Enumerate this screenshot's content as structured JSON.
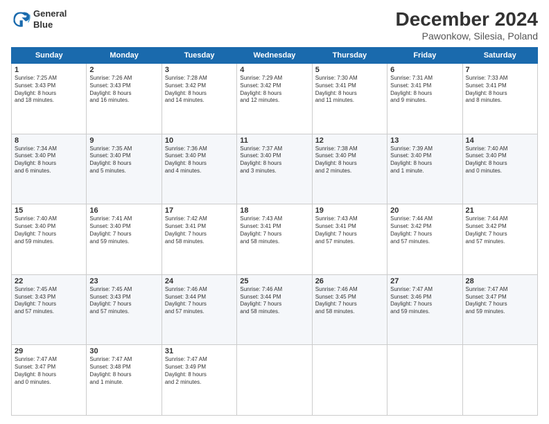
{
  "header": {
    "logo_line1": "General",
    "logo_line2": "Blue",
    "main_title": "December 2024",
    "subtitle": "Pawonkow, Silesia, Poland"
  },
  "weekdays": [
    "Sunday",
    "Monday",
    "Tuesday",
    "Wednesday",
    "Thursday",
    "Friday",
    "Saturday"
  ],
  "weeks": [
    [
      {
        "day": "1",
        "lines": [
          "Sunrise: 7:25 AM",
          "Sunset: 3:43 PM",
          "Daylight: 8 hours",
          "and 18 minutes."
        ]
      },
      {
        "day": "2",
        "lines": [
          "Sunrise: 7:26 AM",
          "Sunset: 3:43 PM",
          "Daylight: 8 hours",
          "and 16 minutes."
        ]
      },
      {
        "day": "3",
        "lines": [
          "Sunrise: 7:28 AM",
          "Sunset: 3:42 PM",
          "Daylight: 8 hours",
          "and 14 minutes."
        ]
      },
      {
        "day": "4",
        "lines": [
          "Sunrise: 7:29 AM",
          "Sunset: 3:42 PM",
          "Daylight: 8 hours",
          "and 12 minutes."
        ]
      },
      {
        "day": "5",
        "lines": [
          "Sunrise: 7:30 AM",
          "Sunset: 3:41 PM",
          "Daylight: 8 hours",
          "and 11 minutes."
        ]
      },
      {
        "day": "6",
        "lines": [
          "Sunrise: 7:31 AM",
          "Sunset: 3:41 PM",
          "Daylight: 8 hours",
          "and 9 minutes."
        ]
      },
      {
        "day": "7",
        "lines": [
          "Sunrise: 7:33 AM",
          "Sunset: 3:41 PM",
          "Daylight: 8 hours",
          "and 8 minutes."
        ]
      }
    ],
    [
      {
        "day": "8",
        "lines": [
          "Sunrise: 7:34 AM",
          "Sunset: 3:40 PM",
          "Daylight: 8 hours",
          "and 6 minutes."
        ]
      },
      {
        "day": "9",
        "lines": [
          "Sunrise: 7:35 AM",
          "Sunset: 3:40 PM",
          "Daylight: 8 hours",
          "and 5 minutes."
        ]
      },
      {
        "day": "10",
        "lines": [
          "Sunrise: 7:36 AM",
          "Sunset: 3:40 PM",
          "Daylight: 8 hours",
          "and 4 minutes."
        ]
      },
      {
        "day": "11",
        "lines": [
          "Sunrise: 7:37 AM",
          "Sunset: 3:40 PM",
          "Daylight: 8 hours",
          "and 3 minutes."
        ]
      },
      {
        "day": "12",
        "lines": [
          "Sunrise: 7:38 AM",
          "Sunset: 3:40 PM",
          "Daylight: 8 hours",
          "and 2 minutes."
        ]
      },
      {
        "day": "13",
        "lines": [
          "Sunrise: 7:39 AM",
          "Sunset: 3:40 PM",
          "Daylight: 8 hours",
          "and 1 minute."
        ]
      },
      {
        "day": "14",
        "lines": [
          "Sunrise: 7:40 AM",
          "Sunset: 3:40 PM",
          "Daylight: 8 hours",
          "and 0 minutes."
        ]
      }
    ],
    [
      {
        "day": "15",
        "lines": [
          "Sunrise: 7:40 AM",
          "Sunset: 3:40 PM",
          "Daylight: 7 hours",
          "and 59 minutes."
        ]
      },
      {
        "day": "16",
        "lines": [
          "Sunrise: 7:41 AM",
          "Sunset: 3:40 PM",
          "Daylight: 7 hours",
          "and 59 minutes."
        ]
      },
      {
        "day": "17",
        "lines": [
          "Sunrise: 7:42 AM",
          "Sunset: 3:41 PM",
          "Daylight: 7 hours",
          "and 58 minutes."
        ]
      },
      {
        "day": "18",
        "lines": [
          "Sunrise: 7:43 AM",
          "Sunset: 3:41 PM",
          "Daylight: 7 hours",
          "and 58 minutes."
        ]
      },
      {
        "day": "19",
        "lines": [
          "Sunrise: 7:43 AM",
          "Sunset: 3:41 PM",
          "Daylight: 7 hours",
          "and 57 minutes."
        ]
      },
      {
        "day": "20",
        "lines": [
          "Sunrise: 7:44 AM",
          "Sunset: 3:42 PM",
          "Daylight: 7 hours",
          "and 57 minutes."
        ]
      },
      {
        "day": "21",
        "lines": [
          "Sunrise: 7:44 AM",
          "Sunset: 3:42 PM",
          "Daylight: 7 hours",
          "and 57 minutes."
        ]
      }
    ],
    [
      {
        "day": "22",
        "lines": [
          "Sunrise: 7:45 AM",
          "Sunset: 3:43 PM",
          "Daylight: 7 hours",
          "and 57 minutes."
        ]
      },
      {
        "day": "23",
        "lines": [
          "Sunrise: 7:45 AM",
          "Sunset: 3:43 PM",
          "Daylight: 7 hours",
          "and 57 minutes."
        ]
      },
      {
        "day": "24",
        "lines": [
          "Sunrise: 7:46 AM",
          "Sunset: 3:44 PM",
          "Daylight: 7 hours",
          "and 57 minutes."
        ]
      },
      {
        "day": "25",
        "lines": [
          "Sunrise: 7:46 AM",
          "Sunset: 3:44 PM",
          "Daylight: 7 hours",
          "and 58 minutes."
        ]
      },
      {
        "day": "26",
        "lines": [
          "Sunrise: 7:46 AM",
          "Sunset: 3:45 PM",
          "Daylight: 7 hours",
          "and 58 minutes."
        ]
      },
      {
        "day": "27",
        "lines": [
          "Sunrise: 7:47 AM",
          "Sunset: 3:46 PM",
          "Daylight: 7 hours",
          "and 59 minutes."
        ]
      },
      {
        "day": "28",
        "lines": [
          "Sunrise: 7:47 AM",
          "Sunset: 3:47 PM",
          "Daylight: 7 hours",
          "and 59 minutes."
        ]
      }
    ],
    [
      {
        "day": "29",
        "lines": [
          "Sunrise: 7:47 AM",
          "Sunset: 3:47 PM",
          "Daylight: 8 hours",
          "and 0 minutes."
        ]
      },
      {
        "day": "30",
        "lines": [
          "Sunrise: 7:47 AM",
          "Sunset: 3:48 PM",
          "Daylight: 8 hours",
          "and 1 minute."
        ]
      },
      {
        "day": "31",
        "lines": [
          "Sunrise: 7:47 AM",
          "Sunset: 3:49 PM",
          "Daylight: 8 hours",
          "and 2 minutes."
        ]
      },
      null,
      null,
      null,
      null
    ]
  ]
}
